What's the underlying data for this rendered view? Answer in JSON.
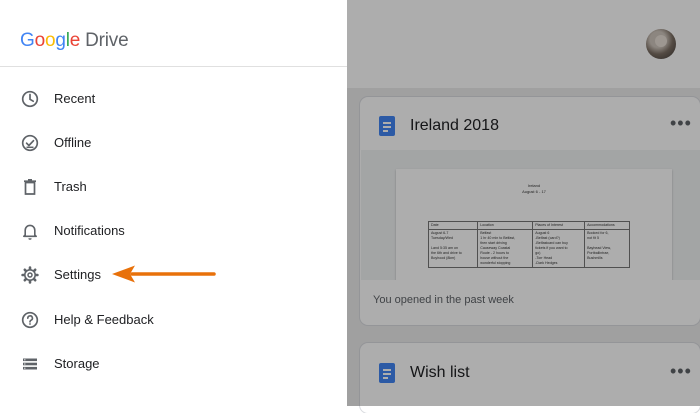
{
  "app": {
    "brand_google_letters": [
      {
        "char": "G",
        "color": "#4285F4"
      },
      {
        "char": "o",
        "color": "#EA4335"
      },
      {
        "char": "o",
        "color": "#FBBC05"
      },
      {
        "char": "g",
        "color": "#4285F4"
      },
      {
        "char": "l",
        "color": "#34A853"
      },
      {
        "char": "e",
        "color": "#EA4335"
      }
    ],
    "brand_product": "Drive"
  },
  "drawer": {
    "items": [
      {
        "label": "Recent",
        "icon": "clock-icon"
      },
      {
        "label": "Offline",
        "icon": "offline-check-icon"
      },
      {
        "label": "Trash",
        "icon": "trash-icon"
      },
      {
        "label": "Notifications",
        "icon": "bell-icon"
      },
      {
        "label": "Settings",
        "icon": "gear-icon"
      },
      {
        "label": "Help & Feedback",
        "icon": "help-icon"
      },
      {
        "label": "Storage",
        "icon": "storage-icon"
      }
    ]
  },
  "annotation": {
    "target": "Settings",
    "arrow_color": "#E8710A"
  },
  "cards": [
    {
      "title": "Ireland 2018",
      "subtitle": "You opened in the past week",
      "preview": {
        "title_line1": "Ireland",
        "title_line2": "August 6 - 17",
        "headers": [
          "Date",
          "Location",
          "Places of Interest",
          "Accommodations"
        ],
        "row": [
          "August 6-7\nTuesday/Wed\n\nLand 5:35 am on\nthe 6th and drive to\nBoyhood (8km)",
          "Belfast\n1 hr 40 min to Belfast,\nthen start driving\nCauseway Coastal\nRoute - 2 hours to\nhouse without the\nwonderful stopping",
          "August 6\n-Belfast (card?)\n-Belfastcard can buy\ntickets if you want to\ngo)\n-Torr Head\n-Dark Hedges",
          "Booked for 6,\nnot fit 5\n\nBayhead View,\nPortballintrae,\nBushmills"
        ]
      }
    },
    {
      "title": "Wish list"
    }
  ],
  "colors": {
    "doc_icon": "#4285F4",
    "overlay": "rgba(0,0,0,0.32)"
  }
}
